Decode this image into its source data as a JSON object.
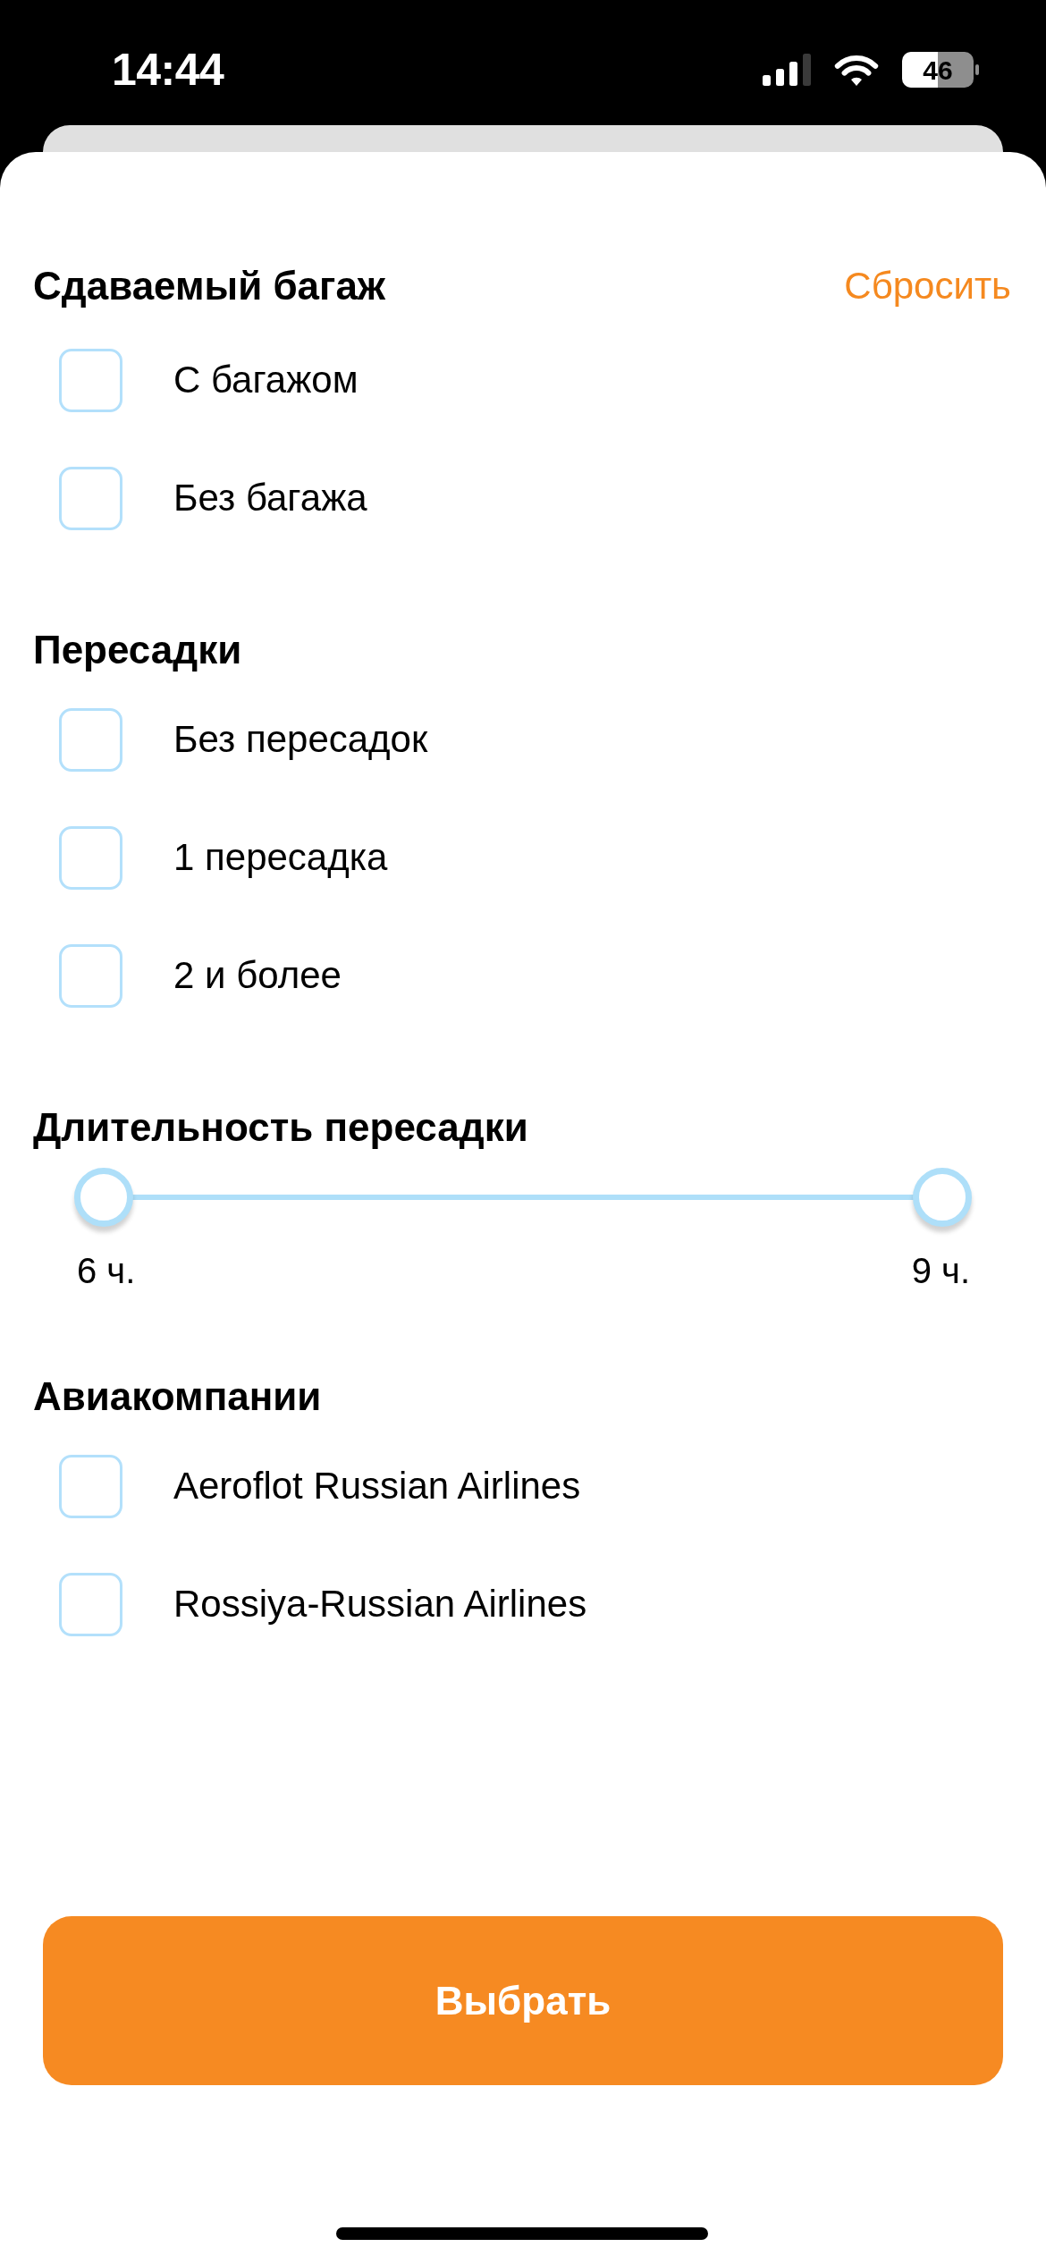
{
  "status_bar": {
    "time": "14:44",
    "battery": "46"
  },
  "sections": [
    {
      "title": "Сдаваемый багаж",
      "action": "Сбросить",
      "kind": "checkboxes",
      "options": [
        {
          "label": "С багажом",
          "checked": false
        },
        {
          "label": "Без багажа",
          "checked": false
        }
      ]
    },
    {
      "title": "Пересадки",
      "kind": "checkboxes",
      "options": [
        {
          "label": "Без пересадок",
          "checked": false
        },
        {
          "label": "1 пересадка",
          "checked": false
        },
        {
          "label": "2 и более",
          "checked": false
        }
      ]
    },
    {
      "title": "Длительность пересадки",
      "kind": "range",
      "thumbs": [
        {
          "level": 0,
          "label": "6 ч."
        },
        {
          "level": 1,
          "label": "9 ч."
        }
      ]
    },
    {
      "title": "Авиакомпании",
      "kind": "checkboxes",
      "options": [
        {
          "label": "Aeroflot Russian Airlines",
          "checked": false
        },
        {
          "label": "Rossiya-Russian Airlines",
          "checked": false
        }
      ]
    }
  ],
  "submit_button": "Выбрать"
}
